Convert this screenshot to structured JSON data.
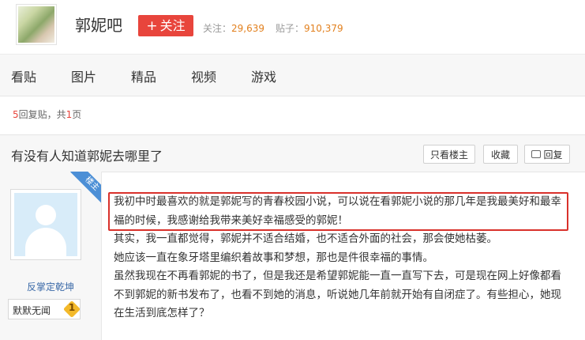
{
  "forum": {
    "name": "郭妮吧",
    "follow_label": "关注",
    "follow_icon": "plus-icon",
    "followers_label": "关注：",
    "followers_value": "29,639",
    "posts_label": "贴子：",
    "posts_value": "910,379"
  },
  "nav": {
    "items": [
      "看贴",
      "图片",
      "精品",
      "视频",
      "游戏"
    ]
  },
  "reply_info": {
    "count": "5",
    "mid": "回复贴，共",
    "pages": "1",
    "suffix": "页"
  },
  "thread": {
    "title": "有没有人知道郭妮去哪里了",
    "only_op": "只看楼主",
    "favorite": "收藏",
    "reply": "回复"
  },
  "post": {
    "badge": "楼主",
    "author": "反掌定乾坤",
    "tag": "默默无闻",
    "level": "1",
    "paragraphs": [
      "我初中时最喜欢的就是郭妮写的青春校园小说，可以说在看郭妮小说的那几年是我最美好和最幸福的时候，我感谢给我带来美好幸福感受的郭妮！",
      "其实，我一直都觉得，郭妮并不适合结婚，也不适合外面的社会，那会使她枯萎。",
      "她应该一直在象牙塔里编织着故事和梦想，那也是件很幸福的事情。",
      "虽然我现在不再看郭妮的书了，但是我还是希望郭妮能一直一直写下去，可是现在网上好像都看不到郭妮的新书发布了，也看不到她的消息，听说她几年前就开始有自闭症了。有些担心，她现在生活到底怎样了？"
    ]
  },
  "colors": {
    "accent": "#e8453c",
    "link": "#3b6aa8",
    "count": "#e2801e",
    "highlight": "#d9312b"
  }
}
